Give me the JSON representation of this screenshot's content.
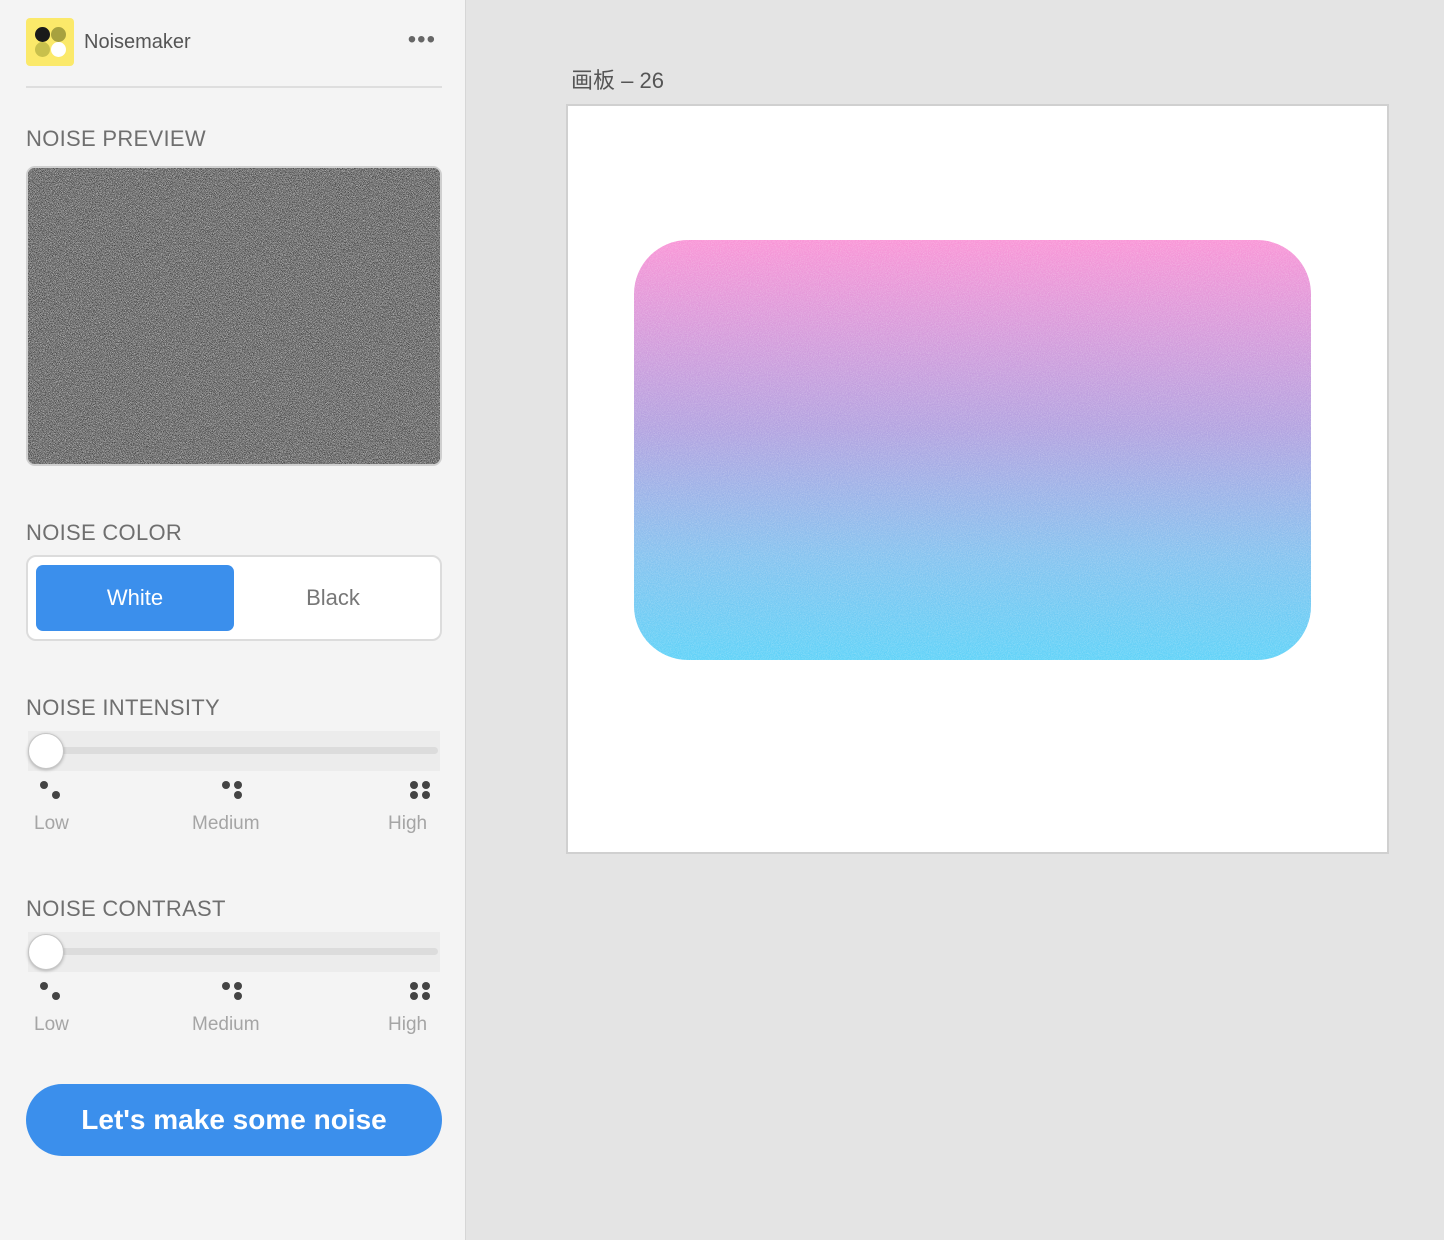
{
  "app": {
    "name": "Noisemaker",
    "more_label": "•••"
  },
  "sections": {
    "preview": "NOISE PREVIEW",
    "color": "NOISE COLOR",
    "intensity": "NOISE INTENSITY",
    "contrast": "NOISE CONTRAST"
  },
  "noise_color": {
    "options": [
      "White",
      "Black"
    ],
    "selected": "White"
  },
  "intensity": {
    "value": 0,
    "levels": [
      "Low",
      "Medium",
      "High"
    ]
  },
  "contrast": {
    "value": 0,
    "levels": [
      "Low",
      "Medium",
      "High"
    ]
  },
  "action": {
    "label": "Let's make some noise"
  },
  "artboard": {
    "title": "画板 – 26"
  },
  "colors": {
    "accent": "#3b8fec",
    "gradient_top": "#f994d6",
    "gradient_bottom": "#5fd2f8",
    "logo_bg": "#fbe96a"
  }
}
